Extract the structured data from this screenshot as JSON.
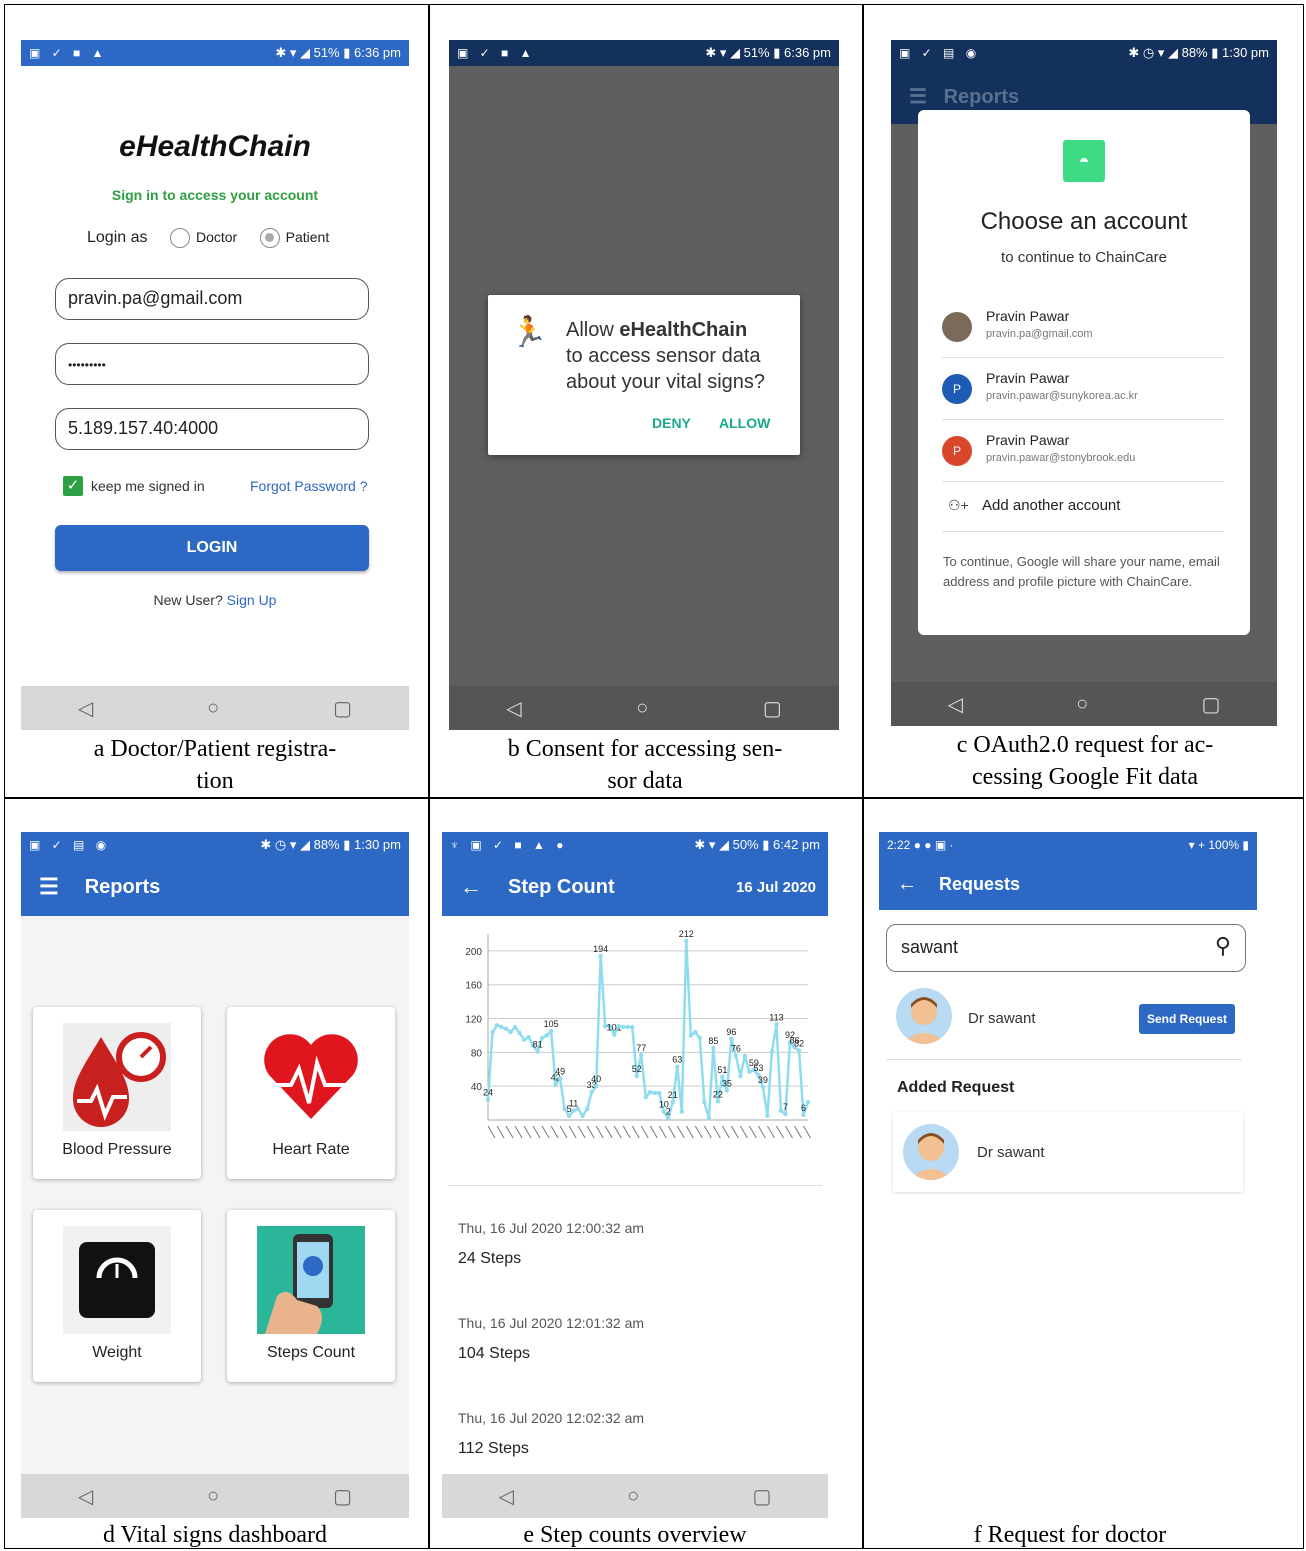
{
  "screens": {
    "a": {
      "status_time": "6:36 pm",
      "status_battery": "51%",
      "app_name": "eHealthChain",
      "subtitle": "Sign in to access your account",
      "login_as_label": "Login as",
      "role_doctor": "Doctor",
      "role_patient": "Patient",
      "email_value": "pravin.pa@gmail.com",
      "password_value": "•••••••••",
      "server_value": "5.189.157.40:4000",
      "keep_signed": "keep me signed in",
      "forgot": "Forgot Password ?",
      "login_button": "LOGIN",
      "new_user": "New User?",
      "sign_up": "Sign Up",
      "caption_line1": "a  Doctor/Patient registra-",
      "caption_line2": "tion"
    },
    "b": {
      "status_time": "6:36 pm",
      "status_battery": "51%",
      "dialog_prefix": "Allow ",
      "dialog_app": "eHealthChain",
      "dialog_line2": "to access sensor data",
      "dialog_line3": "about your vital signs?",
      "deny": "DENY",
      "allow": "ALLOW",
      "caption_line1": "b  Consent for accessing sen-",
      "caption_line2": "sor data"
    },
    "c": {
      "status_time": "1:30 pm",
      "status_battery": "88%",
      "appbar_title": "Reports",
      "choose_title": "Choose an account",
      "choose_sub": "to continue to ChainCare",
      "accounts": [
        {
          "name": "Pravin Pawar",
          "email": "pravin.pa@gmail.com",
          "initial": ""
        },
        {
          "name": "Pravin Pawar",
          "email": "pravin.pawar@sunykorea.ac.kr",
          "initial": "P"
        },
        {
          "name": "Pravin Pawar",
          "email": "pravin.pawar@stonybrook.edu",
          "initial": "P"
        }
      ],
      "add_account": "Add another account",
      "footer": "To continue, Google will share your name, email address and profile picture with ChainCare.",
      "caption_line1": "c  OAuth2.0 request for ac-",
      "caption_line2": "cessing Google Fit data"
    },
    "d": {
      "status_time": "1:30 pm",
      "status_battery": "88%",
      "appbar_title": "Reports",
      "tiles": [
        "Blood Pressure",
        "Heart Rate",
        "Weight",
        "Steps Count"
      ],
      "caption": "d  Vital signs dashboard"
    },
    "e": {
      "status_time": "6:42 pm",
      "status_battery": "50%",
      "appbar_title": "Step Count",
      "appbar_date": "16 Jul 2020",
      "entries": [
        {
          "date": "Thu, 16 Jul 2020  12:00:32 am",
          "steps": "24 Steps"
        },
        {
          "date": "Thu, 16 Jul 2020  12:01:32 am",
          "steps": "104 Steps"
        },
        {
          "date": "Thu, 16 Jul 2020  12:02:32 am",
          "steps": "112 Steps"
        }
      ],
      "caption": "e  Step counts overview"
    },
    "f": {
      "status_time": "2:22",
      "status_battery": "100%",
      "appbar_title": "Requests",
      "search_value": "sawant",
      "doctor_name": "Dr sawant",
      "send_request": "Send Request",
      "added_header": "Added Request",
      "added_name": "Dr sawant",
      "caption": "f  Request for doctor"
    }
  },
  "chart_data": {
    "type": "line",
    "ylim": [
      0,
      220
    ],
    "yticks": [
      40,
      80,
      120,
      160,
      200
    ],
    "values": [
      24,
      104,
      112,
      110,
      108,
      104,
      110,
      103,
      95,
      98,
      88,
      81,
      97,
      100,
      105,
      42,
      49,
      13,
      5,
      11,
      13,
      5,
      13,
      33,
      40,
      194,
      111,
      111,
      101,
      111,
      110,
      110,
      110,
      52,
      77,
      27,
      33,
      32,
      32,
      10,
      2,
      21,
      63,
      10,
      212,
      100,
      104,
      97,
      21,
      2,
      85,
      22,
      51,
      35,
      96,
      76,
      52,
      76,
      57,
      59,
      53,
      39,
      5,
      81,
      113,
      11,
      7,
      92,
      86,
      82,
      6,
      21
    ],
    "labels_shown": [
      "24",
      "194",
      "212",
      "113",
      "105",
      "101",
      "77",
      "63",
      "52",
      "49",
      "42",
      "40",
      "33",
      "85",
      "96",
      "76",
      "81",
      "92",
      "86",
      "82",
      "51",
      "35",
      "22",
      "59",
      "53",
      "39",
      "10",
      "2",
      "21",
      "5",
      "7",
      "11",
      "6"
    ],
    "line_color": "#8fdcef"
  },
  "colors": {
    "primary": "#2c68c4",
    "green_text": "#2ea043",
    "link": "#2c68c4",
    "dialog_button": "#1aa98c"
  }
}
